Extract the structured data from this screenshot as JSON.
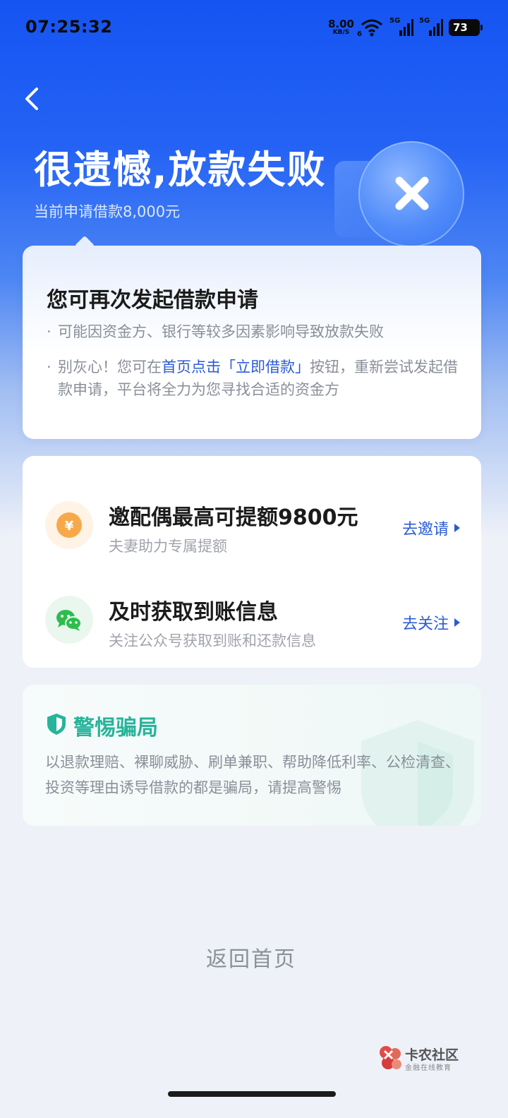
{
  "status_bar": {
    "time": "07:25:32",
    "net_speed_value": "8.00",
    "net_speed_unit": "KB/S",
    "wifi_tag": "6",
    "sim1_tag": "5G",
    "sim2_tag": "5G",
    "battery": "73"
  },
  "header": {
    "title": "很遗憾,放款失败",
    "subtitle": "当前申请借款8,000元",
    "back_icon": "chevron-left-icon",
    "illustration_icon": "close-x-icon"
  },
  "notice_card": {
    "title": "您可再次发起借款申请",
    "bullet1": "可能因资金方、银行等较多因素影响导致放款失败",
    "bullet2_prefix": "别灰心！您可在",
    "bullet2_highlight": "首页点击「立即借款」",
    "bullet2_suffix": "按钮，重新尝试发起借款申请，平台将全力为您寻找合适的资金方"
  },
  "actions": [
    {
      "icon": "yen-coin-icon",
      "title": "邀配偶最高可提额9800元",
      "subtitle": "夫妻助力专属提额",
      "link": "去邀请"
    },
    {
      "icon": "wechat-icon",
      "title": "及时获取到账信息",
      "subtitle": "关注公众号获取到账和还款信息",
      "link": "去关注"
    }
  ],
  "warning": {
    "title": "警惕骗局",
    "text": "以退款理赔、裸聊威胁、刷单兼职、帮助降低利率、公检清查、投资等理由诱导借款的都是骗局，请提高警惕",
    "icon": "shield-icon"
  },
  "footer": {
    "home_link": "返回首页"
  },
  "watermark": {
    "name": "卡农社区",
    "sub": "金融在线教育"
  },
  "colors": {
    "brand_blue": "#1554f2",
    "link_blue": "#2a5bd7",
    "warn_green": "#27b49a"
  }
}
